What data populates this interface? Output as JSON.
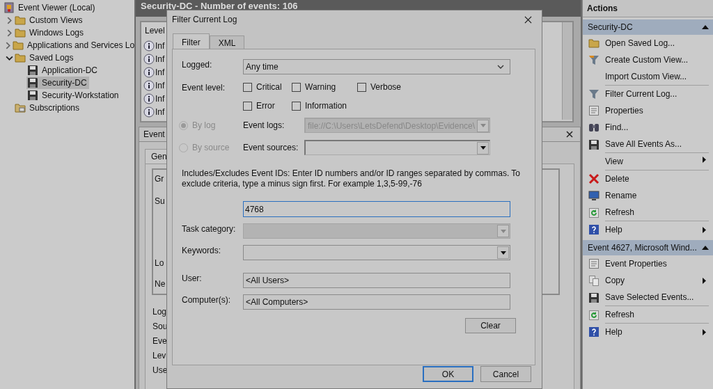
{
  "tree": {
    "label": "Event Viewer (Local)",
    "selected": false,
    "children": [
      {
        "label": "Custom Views",
        "kind": "group",
        "expanded": false,
        "selected": false
      },
      {
        "label": "Windows Logs",
        "kind": "group",
        "expanded": false,
        "selected": false
      },
      {
        "label": "Applications and Services Lo",
        "kind": "group",
        "expanded": false,
        "selected": false
      },
      {
        "label": "Saved Logs",
        "kind": "group",
        "expanded": true,
        "selected": false,
        "children": [
          {
            "label": "Application-DC",
            "selected": false
          },
          {
            "label": "Security-DC",
            "selected": true
          },
          {
            "label": "Security-Workstation",
            "selected": false
          }
        ]
      },
      {
        "label": "Subscriptions",
        "kind": "item",
        "selected": false
      }
    ]
  },
  "log_header": "Security-DC - Number of events: 106",
  "event_list": {
    "column": "Level",
    "rows": [
      "Inf",
      "Inf",
      "Inf",
      "Inf",
      "Inf",
      "Inf"
    ]
  },
  "event_detail": {
    "title": "Event",
    "tab": "Gen",
    "box_labels": [
      "Gr",
      "Su",
      "Lo",
      "Ne"
    ],
    "labels": [
      "Log",
      "Sou",
      "Eve",
      "Lev",
      "Use"
    ]
  },
  "dialog": {
    "title": "Filter Current Log",
    "tabs": [
      {
        "label": "Filter",
        "selected": true
      },
      {
        "label": "XML",
        "selected": false
      }
    ],
    "logged": {
      "label": "Logged:",
      "value": "Any time"
    },
    "event_level": {
      "label": "Event level:",
      "options": [
        {
          "label": "Critical",
          "checked": false
        },
        {
          "label": "Warning",
          "checked": false
        },
        {
          "label": "Verbose",
          "checked": false
        },
        {
          "label": "Error",
          "checked": false
        },
        {
          "label": "Information",
          "checked": false
        }
      ]
    },
    "source_modes": [
      {
        "label": "By log",
        "selected": true,
        "disabled": true,
        "field_label": "Event logs:",
        "value": "file://C:\\Users\\LetsDefend\\Desktop\\Evidence\\"
      },
      {
        "label": "By source",
        "selected": false,
        "disabled": true,
        "field_label": "Event sources:"
      }
    ],
    "ids_note": "Includes/Excludes Event IDs: Enter ID numbers and/or ID ranges separated by commas. To exclude criteria, type a minus sign first. For example 1,3,5-99,-76",
    "ids_value": "4768",
    "fields": [
      {
        "label": "Task category:",
        "kind": "dropdown",
        "disabled": true
      },
      {
        "label": "Keywords:",
        "kind": "dropdown",
        "disabled": false
      },
      {
        "label": "User:",
        "kind": "text",
        "disabled": false,
        "value": "<All Users>"
      },
      {
        "label": "Computer(s):",
        "kind": "text",
        "disabled": false,
        "value": "<All Computers>"
      }
    ],
    "clear_button": "Clear",
    "buttons": [
      {
        "label": "OK",
        "default": true
      },
      {
        "label": "Cancel",
        "default": false
      }
    ]
  },
  "actions": {
    "title": "Actions",
    "sections": [
      {
        "title": "Security-DC",
        "expanded": true,
        "items": [
          {
            "label": "Open Saved Log...",
            "submenu": false,
            "divider_after": false
          },
          {
            "label": "Create Custom View...",
            "submenu": false,
            "divider_after": false
          },
          {
            "label": "Import Custom View...",
            "submenu": false,
            "divider_after": true
          },
          {
            "label": "Filter Current Log...",
            "submenu": false,
            "divider_after": false
          },
          {
            "label": "Properties",
            "submenu": false,
            "divider_after": false
          },
          {
            "label": "Find...",
            "submenu": false,
            "divider_after": false
          },
          {
            "label": "Save All Events As...",
            "submenu": false,
            "divider_after": true
          },
          {
            "label": "View",
            "submenu": true,
            "divider_after": true
          },
          {
            "label": "Delete",
            "submenu": false,
            "divider_after": false
          },
          {
            "label": "Rename",
            "submenu": false,
            "divider_after": false
          },
          {
            "label": "Refresh",
            "submenu": false,
            "divider_after": true
          },
          {
            "label": "Help",
            "submenu": true,
            "divider_after": false
          }
        ]
      },
      {
        "title": "Event 4627, Microsoft Wind...",
        "expanded": true,
        "items": [
          {
            "label": "Event Properties",
            "submenu": false,
            "divider_after": false
          },
          {
            "label": "Copy",
            "submenu": true,
            "divider_after": false
          },
          {
            "label": "Save Selected Events...",
            "submenu": false,
            "divider_after": true
          },
          {
            "label": "Refresh",
            "submenu": false,
            "divider_after": true
          },
          {
            "label": "Help",
            "submenu": true,
            "divider_after": false
          }
        ]
      }
    ]
  }
}
